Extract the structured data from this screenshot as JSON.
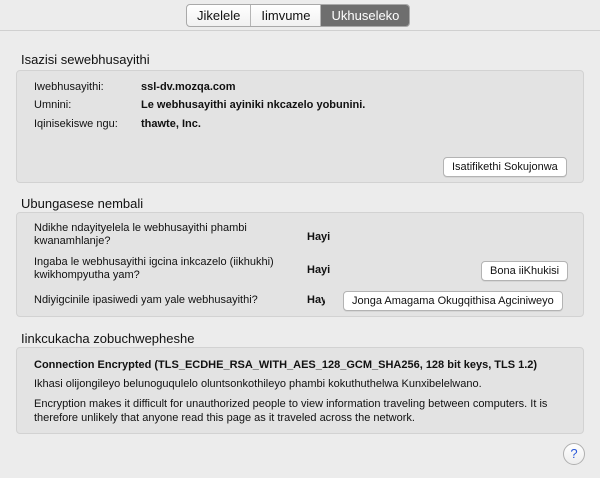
{
  "tabs": [
    {
      "label": "Jikelele",
      "active": false
    },
    {
      "label": "Iimvume",
      "active": false
    },
    {
      "label": "Ukhuseleko",
      "active": true
    }
  ],
  "website_identity": {
    "title": "Isazisi sewebhusayithi",
    "rows": [
      {
        "label": "Iwebhusayithi:",
        "value": "ssl-dv.mozqa.com"
      },
      {
        "label": "Umnini:",
        "value": "Le webhusayithi ayiniki nkcazelo yobunini."
      },
      {
        "label": "Iqinisekiswe ngu:",
        "value": "thawte, Inc."
      }
    ],
    "view_certificate_label": "Isatifikethi Sokujonwa"
  },
  "privacy_history": {
    "title": "Ubungasese nembali",
    "rows": [
      {
        "question": "Ndikhe ndayityelela le webhusayithi phambi kwanamhlanje?",
        "answer": "Hayi",
        "button": ""
      },
      {
        "question": "Ingaba le webhusayithi igcina inkcazelo (iikhukhi) kwikhompyutha yam?",
        "answer": "Hayi",
        "button": "Bona iiKhukisi"
      },
      {
        "question": "Ndiyigcinile ipasiwedi yam yale webhusayithi?",
        "answer": "Hay",
        "button": "Jonga Amagama Okugqithisa Agciniweyo"
      }
    ]
  },
  "technical": {
    "title": "Iinkcukacha zobuchwepheshe",
    "connection": "Connection Encrypted (TLS_ECDHE_RSA_WITH_AES_128_GCM_SHA256, 128 bit keys, TLS 1.2)",
    "page_note": "Ikhasi olijongileyo belunoguqulelo oluntsonkothileyo phambi kokuthuthelwa Kunxibelelwano.",
    "explanation": "Encryption makes it difficult for unauthorized people to view information traveling between computers. It is therefore unlikely that anyone read this page as it traveled across the network."
  },
  "help_label": "?",
  "colors": {
    "active_tab": "#6e6e6e",
    "panel": "#e3e3e3",
    "window": "#ececec"
  }
}
